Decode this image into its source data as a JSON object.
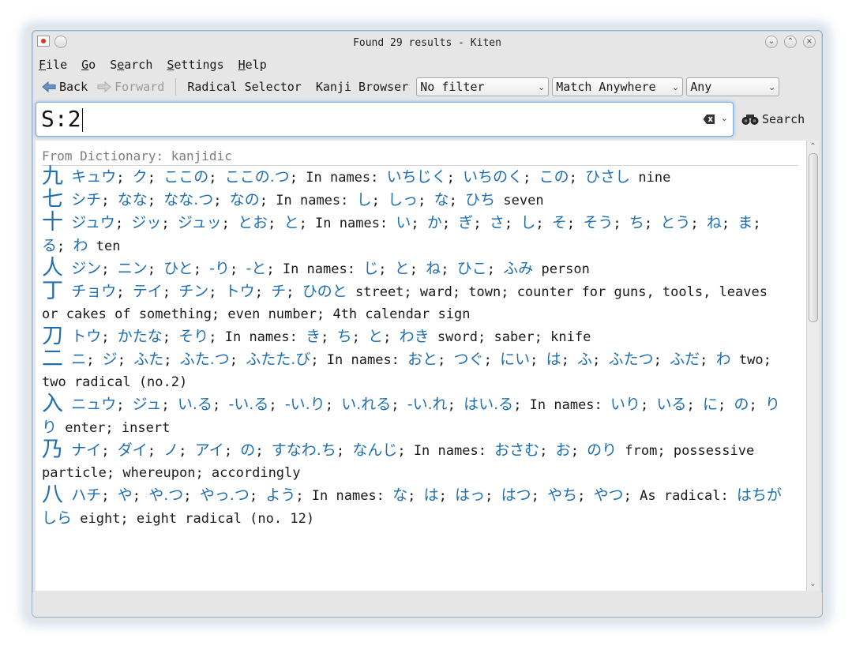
{
  "window": {
    "title": "Found 29 results - Kiten"
  },
  "menu": [
    {
      "pre": "",
      "u": "F",
      "post": "ile"
    },
    {
      "pre": "",
      "u": "G",
      "post": "o"
    },
    {
      "pre": "S",
      "u": "e",
      "post": "arch"
    },
    {
      "pre": "",
      "u": "S",
      "post": "ettings"
    },
    {
      "pre": "",
      "u": "H",
      "post": "elp"
    }
  ],
  "toolbar": {
    "back": "Back",
    "forward": "Forward",
    "radical_selector": "Radical Selector",
    "kanji_browser": "Kanji Browser",
    "filter": "No filter",
    "match": "Match Anywhere",
    "type": "Any"
  },
  "search": {
    "value": "S:2",
    "button": "Search"
  },
  "results": {
    "from": "From Dictionary: kanjidic",
    "entries": [
      {
        "kanji": "九",
        "parts": [
          [
            "r",
            "キュウ"
          ],
          [
            "s",
            "; "
          ],
          [
            "r",
            "ク"
          ],
          [
            "s",
            "; "
          ],
          [
            "r",
            "ここの"
          ],
          [
            "s",
            "; "
          ],
          [
            "r",
            "ここの.つ"
          ],
          [
            "s",
            "; In names: "
          ],
          [
            "r",
            "いちじく"
          ],
          [
            "s",
            "; "
          ],
          [
            "r",
            "いちのく"
          ],
          [
            "s",
            "; "
          ],
          [
            "r",
            "この"
          ],
          [
            "s",
            "; "
          ],
          [
            "r",
            "ひさし"
          ],
          [
            "s",
            " nine"
          ]
        ]
      },
      {
        "kanji": "七",
        "parts": [
          [
            "r",
            "シチ"
          ],
          [
            "s",
            "; "
          ],
          [
            "r",
            "なな"
          ],
          [
            "s",
            "; "
          ],
          [
            "r",
            "なな.つ"
          ],
          [
            "s",
            "; "
          ],
          [
            "r",
            "なの"
          ],
          [
            "s",
            "; In names: "
          ],
          [
            "r",
            "し"
          ],
          [
            "s",
            "; "
          ],
          [
            "r",
            "しっ"
          ],
          [
            "s",
            "; "
          ],
          [
            "r",
            "な"
          ],
          [
            "s",
            "; "
          ],
          [
            "r",
            "ひち"
          ],
          [
            "s",
            " seven"
          ]
        ]
      },
      {
        "kanji": "十",
        "parts": [
          [
            "r",
            "ジュウ"
          ],
          [
            "s",
            "; "
          ],
          [
            "r",
            "ジッ"
          ],
          [
            "s",
            "; "
          ],
          [
            "r",
            "ジュッ"
          ],
          [
            "s",
            "; "
          ],
          [
            "r",
            "とお"
          ],
          [
            "s",
            "; "
          ],
          [
            "r",
            "と"
          ],
          [
            "s",
            "; In names: "
          ],
          [
            "r",
            "い"
          ],
          [
            "s",
            "; "
          ],
          [
            "r",
            "か"
          ],
          [
            "s",
            "; "
          ],
          [
            "r",
            "ぎ"
          ],
          [
            "s",
            "; "
          ],
          [
            "r",
            "さ"
          ],
          [
            "s",
            "; "
          ],
          [
            "r",
            "し"
          ],
          [
            "s",
            "; "
          ],
          [
            "r",
            "そ"
          ],
          [
            "s",
            "; "
          ],
          [
            "r",
            "そう"
          ],
          [
            "s",
            "; "
          ],
          [
            "r",
            "ち"
          ],
          [
            "s",
            "; "
          ],
          [
            "r",
            "とう"
          ],
          [
            "s",
            "; "
          ],
          [
            "r",
            "ね"
          ],
          [
            "s",
            "; "
          ],
          [
            "r",
            "ま"
          ],
          [
            "s",
            "; "
          ],
          [
            "r",
            "る"
          ],
          [
            "s",
            "; "
          ],
          [
            "r",
            "わ"
          ],
          [
            "s",
            " ten"
          ]
        ]
      },
      {
        "kanji": "人",
        "parts": [
          [
            "r",
            "ジン"
          ],
          [
            "s",
            "; "
          ],
          [
            "r",
            "ニン"
          ],
          [
            "s",
            "; "
          ],
          [
            "r",
            "ひと"
          ],
          [
            "s",
            "; "
          ],
          [
            "r",
            "-り"
          ],
          [
            "s",
            "; "
          ],
          [
            "r",
            "-と"
          ],
          [
            "s",
            "; In names: "
          ],
          [
            "r",
            "じ"
          ],
          [
            "s",
            "; "
          ],
          [
            "r",
            "と"
          ],
          [
            "s",
            "; "
          ],
          [
            "r",
            "ね"
          ],
          [
            "s",
            "; "
          ],
          [
            "r",
            "ひこ"
          ],
          [
            "s",
            "; "
          ],
          [
            "r",
            "ふみ"
          ],
          [
            "s",
            " person"
          ]
        ]
      },
      {
        "kanji": "丁",
        "parts": [
          [
            "r",
            "チョウ"
          ],
          [
            "s",
            "; "
          ],
          [
            "r",
            "テイ"
          ],
          [
            "s",
            "; "
          ],
          [
            "r",
            "チン"
          ],
          [
            "s",
            "; "
          ],
          [
            "r",
            "トウ"
          ],
          [
            "s",
            "; "
          ],
          [
            "r",
            "チ"
          ],
          [
            "s",
            "; "
          ],
          [
            "r",
            "ひのと"
          ],
          [
            "s",
            " street; ward; town; counter for guns, tools, leaves or cakes of something; even number; 4th calendar sign"
          ]
        ]
      },
      {
        "kanji": "刀",
        "parts": [
          [
            "r",
            "トウ"
          ],
          [
            "s",
            "; "
          ],
          [
            "r",
            "かたな"
          ],
          [
            "s",
            "; "
          ],
          [
            "r",
            "そり"
          ],
          [
            "s",
            "; In names: "
          ],
          [
            "r",
            "き"
          ],
          [
            "s",
            "; "
          ],
          [
            "r",
            "ち"
          ],
          [
            "s",
            "; "
          ],
          [
            "r",
            "と"
          ],
          [
            "s",
            "; "
          ],
          [
            "r",
            "わき"
          ],
          [
            "s",
            " sword; saber; knife"
          ]
        ]
      },
      {
        "kanji": "二",
        "parts": [
          [
            "r",
            "ニ"
          ],
          [
            "s",
            "; "
          ],
          [
            "r",
            "ジ"
          ],
          [
            "s",
            "; "
          ],
          [
            "r",
            "ふた"
          ],
          [
            "s",
            "; "
          ],
          [
            "r",
            "ふた.つ"
          ],
          [
            "s",
            "; "
          ],
          [
            "r",
            "ふたた.び"
          ],
          [
            "s",
            "; In names: "
          ],
          [
            "r",
            "おと"
          ],
          [
            "s",
            "; "
          ],
          [
            "r",
            "つぐ"
          ],
          [
            "s",
            "; "
          ],
          [
            "r",
            "にい"
          ],
          [
            "s",
            "; "
          ],
          [
            "r",
            "は"
          ],
          [
            "s",
            "; "
          ],
          [
            "r",
            "ふ"
          ],
          [
            "s",
            "; "
          ],
          [
            "r",
            "ふたつ"
          ],
          [
            "s",
            "; "
          ],
          [
            "r",
            "ふだ"
          ],
          [
            "s",
            "; "
          ],
          [
            "r",
            "わ"
          ],
          [
            "s",
            " two; two radical (no.2)"
          ]
        ]
      },
      {
        "kanji": "入",
        "parts": [
          [
            "r",
            "ニュウ"
          ],
          [
            "s",
            "; "
          ],
          [
            "r",
            "ジュ"
          ],
          [
            "s",
            "; "
          ],
          [
            "r",
            "い.る"
          ],
          [
            "s",
            "; "
          ],
          [
            "r",
            "-い.る"
          ],
          [
            "s",
            "; "
          ],
          [
            "r",
            "-い.り"
          ],
          [
            "s",
            "; "
          ],
          [
            "r",
            "い.れる"
          ],
          [
            "s",
            "; "
          ],
          [
            "r",
            "-い.れ"
          ],
          [
            "s",
            "; "
          ],
          [
            "r",
            "はい.る"
          ],
          [
            "s",
            "; In names: "
          ],
          [
            "r",
            "いり"
          ],
          [
            "s",
            "; "
          ],
          [
            "r",
            "いる"
          ],
          [
            "s",
            "; "
          ],
          [
            "r",
            "に"
          ],
          [
            "s",
            "; "
          ],
          [
            "r",
            "の"
          ],
          [
            "s",
            "; "
          ],
          [
            "r",
            "りり"
          ],
          [
            "s",
            " enter; insert"
          ]
        ]
      },
      {
        "kanji": "乃",
        "parts": [
          [
            "r",
            "ナイ"
          ],
          [
            "s",
            "; "
          ],
          [
            "r",
            "ダイ"
          ],
          [
            "s",
            "; "
          ],
          [
            "r",
            "ノ"
          ],
          [
            "s",
            "; "
          ],
          [
            "r",
            "アイ"
          ],
          [
            "s",
            "; "
          ],
          [
            "r",
            "の"
          ],
          [
            "s",
            "; "
          ],
          [
            "r",
            "すなわ.ち"
          ],
          [
            "s",
            "; "
          ],
          [
            "r",
            "なんじ"
          ],
          [
            "s",
            "; In names: "
          ],
          [
            "r",
            "おさむ"
          ],
          [
            "s",
            "; "
          ],
          [
            "r",
            "お"
          ],
          [
            "s",
            "; "
          ],
          [
            "r",
            "のり"
          ],
          [
            "s",
            " from; possessive particle; whereupon; accordingly"
          ]
        ]
      },
      {
        "kanji": "八",
        "parts": [
          [
            "r",
            "ハチ"
          ],
          [
            "s",
            "; "
          ],
          [
            "r",
            "や"
          ],
          [
            "s",
            "; "
          ],
          [
            "r",
            "や.つ"
          ],
          [
            "s",
            "; "
          ],
          [
            "r",
            "やっ.つ"
          ],
          [
            "s",
            "; "
          ],
          [
            "r",
            "よう"
          ],
          [
            "s",
            "; In names: "
          ],
          [
            "r",
            "な"
          ],
          [
            "s",
            "; "
          ],
          [
            "r",
            "は"
          ],
          [
            "s",
            "; "
          ],
          [
            "r",
            "はっ"
          ],
          [
            "s",
            "; "
          ],
          [
            "r",
            "はつ"
          ],
          [
            "s",
            "; "
          ],
          [
            "r",
            "やち"
          ],
          [
            "s",
            "; "
          ],
          [
            "r",
            "やつ"
          ],
          [
            "s",
            "; As radical: "
          ],
          [
            "r",
            "はちがしら"
          ],
          [
            "s",
            " eight; eight radical (no. 12)"
          ]
        ]
      }
    ]
  },
  "colors": {
    "reading": "#1f6fb0",
    "focus_border": "#7fb2df"
  }
}
